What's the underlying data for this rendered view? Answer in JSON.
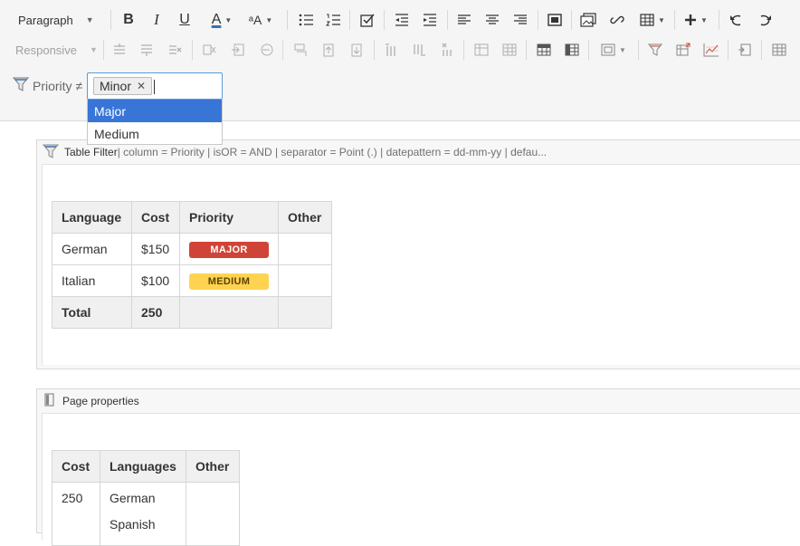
{
  "toolbar": {
    "paragraph_label": "Paragraph",
    "responsive_label": "Responsive",
    "bold_label": "B",
    "italic_label": "I",
    "underline_label": "U",
    "text_color_label": "A",
    "text_color_accent": "#3572b0",
    "font_size_label": "ᵃA"
  },
  "filter": {
    "label": "Priority ≠",
    "tag": "Minor",
    "tag_remove": "✕",
    "options": [
      "Major",
      "Medium"
    ]
  },
  "table_filter_macro": {
    "title": "Table Filter",
    "params": " | column = Priority | isOR = AND | separator = Point (.) | datepattern = dd-mm-yy | defau...",
    "headers": [
      "Language",
      "Cost",
      "Priority",
      "Other"
    ],
    "rows": [
      {
        "language": "German",
        "cost": "$150",
        "priority": "MAJOR",
        "other": ""
      },
      {
        "language": "Italian",
        "cost": "$100",
        "priority": "MEDIUM",
        "other": ""
      }
    ],
    "total": {
      "label": "Total",
      "value": "250"
    },
    "colors": {
      "major": "#d04437",
      "medium": "#ffd351"
    }
  },
  "page_properties_macro": {
    "title": "Page properties",
    "headers": [
      "Cost",
      "Languages",
      "Other"
    ],
    "rows": [
      {
        "cost": "250",
        "languages": [
          "German",
          "Spanish"
        ],
        "other": ""
      }
    ]
  }
}
